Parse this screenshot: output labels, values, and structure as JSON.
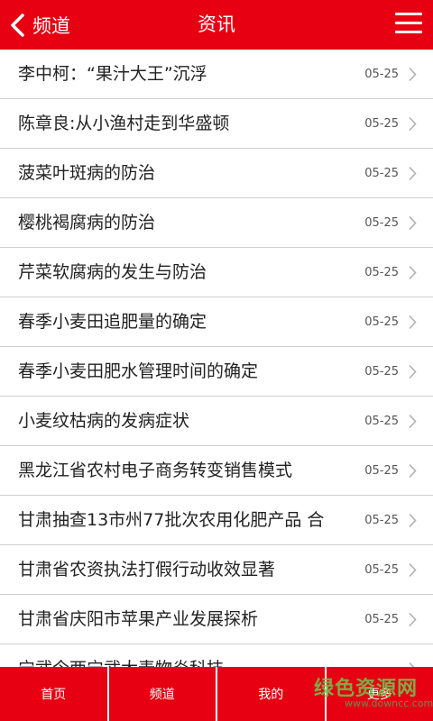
{
  "header": {
    "back_label": "频道",
    "title": "资讯"
  },
  "list": [
    {
      "title": "李中柯：“果汁大王”沉浮",
      "date": "05-25"
    },
    {
      "title": "陈章良:从小渔村走到华盛顿",
      "date": "05-25"
    },
    {
      "title": "菠菜叶斑病的防治",
      "date": "05-25"
    },
    {
      "title": "樱桃褐腐病的防治",
      "date": "05-25"
    },
    {
      "title": "芹菜软腐病的发生与防治",
      "date": "05-25"
    },
    {
      "title": "春季小麦田追肥量的确定",
      "date": "05-25"
    },
    {
      "title": "春季小麦田肥水管理时间的确定",
      "date": "05-25"
    },
    {
      "title": "小麦纹枯病的发病症状",
      "date": "05-25"
    },
    {
      "title": "黑龙江省农村电子商务转变销售模式",
      "date": "05-25"
    },
    {
      "title": "甘肃抽查13市州77批次农用化肥产品 合",
      "date": "05-25"
    },
    {
      "title": "甘肃省农资执法打假行动收效显著",
      "date": "05-25"
    },
    {
      "title": "甘肃省庆阳市苹果产业发展探析",
      "date": "05-25"
    },
    {
      "title": "宁武今两宁武大麦物炎科技",
      "date": ""
    }
  ],
  "tabs": [
    {
      "label": "首页"
    },
    {
      "label": "频道"
    },
    {
      "label": "我的"
    },
    {
      "label": "更多"
    }
  ],
  "watermark": {
    "text": "绿色资源网",
    "url": "www.downcc.com"
  },
  "colors": {
    "brand": "#e60012",
    "divider": "#cfcfcf"
  }
}
